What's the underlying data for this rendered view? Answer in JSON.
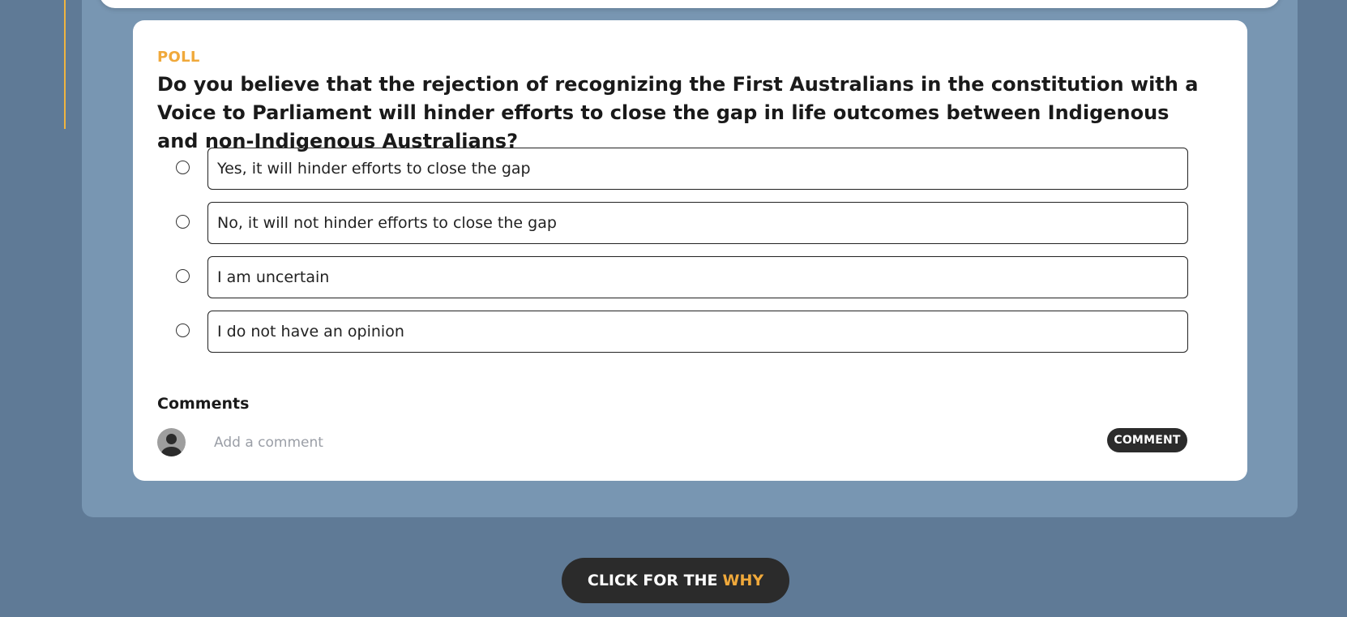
{
  "poll": {
    "tag": "POLL",
    "question": "Do you believe that the rejection of recognizing the First Australians in the constitution with a Voice to Parliament will hinder efforts to close the gap in life outcomes between Indigenous and non-Indigenous Australians?",
    "options": [
      {
        "label": "Yes, it will hinder efforts to close the gap",
        "selected": false
      },
      {
        "label": "No, it will not hinder efforts to close the gap",
        "selected": false
      },
      {
        "label": "I am uncertain",
        "selected": false
      },
      {
        "label": "I do not have an opinion",
        "selected": false
      }
    ]
  },
  "comments": {
    "title": "Comments",
    "input_placeholder": "Add a comment",
    "input_value": "",
    "button_label": "COMMENT",
    "avatar_icon": "user-avatar-icon"
  },
  "footer": {
    "why_button_prefix": "CLICK FOR THE",
    "why_button_accent": "WHY"
  },
  "colors": {
    "page_background": "#5f7a96",
    "panel_background": "#7896b2",
    "accent": "#f0a93b",
    "dark_button": "#2b2b2b"
  }
}
